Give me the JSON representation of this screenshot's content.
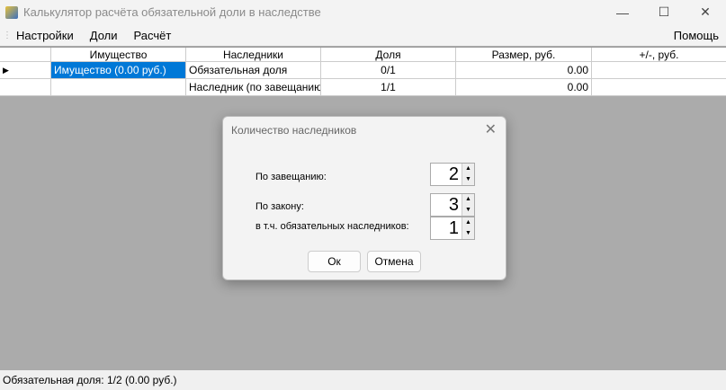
{
  "window": {
    "title": "Калькулятор расчёта обязательной доли в наследстве",
    "minimize": "—",
    "maximize": "☐",
    "close": "✕"
  },
  "menu": {
    "items": [
      "Настройки",
      "Доли",
      "Расчёт"
    ],
    "help": "Помощь"
  },
  "table": {
    "headers": [
      "",
      "Имущество",
      "Наследники",
      "Доля",
      "Размер, руб.",
      "+/-, руб."
    ],
    "rows": [
      {
        "marker": "▶",
        "property": "Имущество (0.00 руб.)",
        "heir": "Обязательная доля",
        "share": "0/1",
        "size": "0.00",
        "diff": ""
      },
      {
        "marker": "",
        "property": "",
        "heir": "Наследник (по завещанию)",
        "share": "1/1",
        "size": "0.00",
        "diff": ""
      }
    ]
  },
  "status": "Обязательная доля: 1/2 (0.00 руб.)",
  "dialog": {
    "title": "Количество наследников",
    "close": "✕",
    "by_will_label": "По завещанию:",
    "by_will": "2",
    "by_law_label": "По закону:",
    "by_law": "3",
    "mandatory_label": "в т.ч. обязательных наследников:",
    "mandatory": "1",
    "ok": "Ок",
    "cancel": "Отмена",
    "up": "▲",
    "down": "▼"
  }
}
